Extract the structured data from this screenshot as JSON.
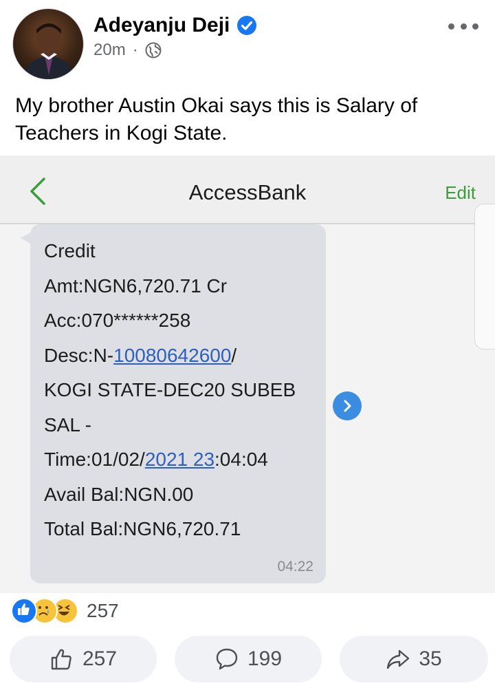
{
  "post": {
    "author": "Adeyanju Deji",
    "time": "20m",
    "separator": "·",
    "text": "My brother Austin Okai says this is Salary of Teachers in Kogi State."
  },
  "embedded_screenshot": {
    "title": "AccessBank",
    "edit_label": "Edit",
    "message": {
      "line1": "Credit",
      "line2": "Amt:NGN6,720.71 Cr",
      "line3": "Acc:070******258",
      "line4_prefix": "Desc:N-",
      "line4_link": "10080642600",
      "line4_suffix": "/",
      "line5": "KOGI STATE-DEC20 SUBEB",
      "line6": "SAL -",
      "line7_prefix": "Time:01/02/",
      "line7_link": "2021 23",
      "line7_suffix": ":04:04",
      "line8": "Avail Bal:NGN.00",
      "line9": "Total Bal:NGN6,720.71",
      "timestamp": "04:22"
    }
  },
  "reactions": {
    "types": [
      "like",
      "sad",
      "haha"
    ],
    "count": "257"
  },
  "actions": {
    "like_count": "257",
    "comment_count": "199",
    "share_count": "35"
  },
  "colors": {
    "verified": "#1877f2",
    "link": "#2d5fbd",
    "edit": "#3a9d3a",
    "bubble": "#dedfe4"
  }
}
